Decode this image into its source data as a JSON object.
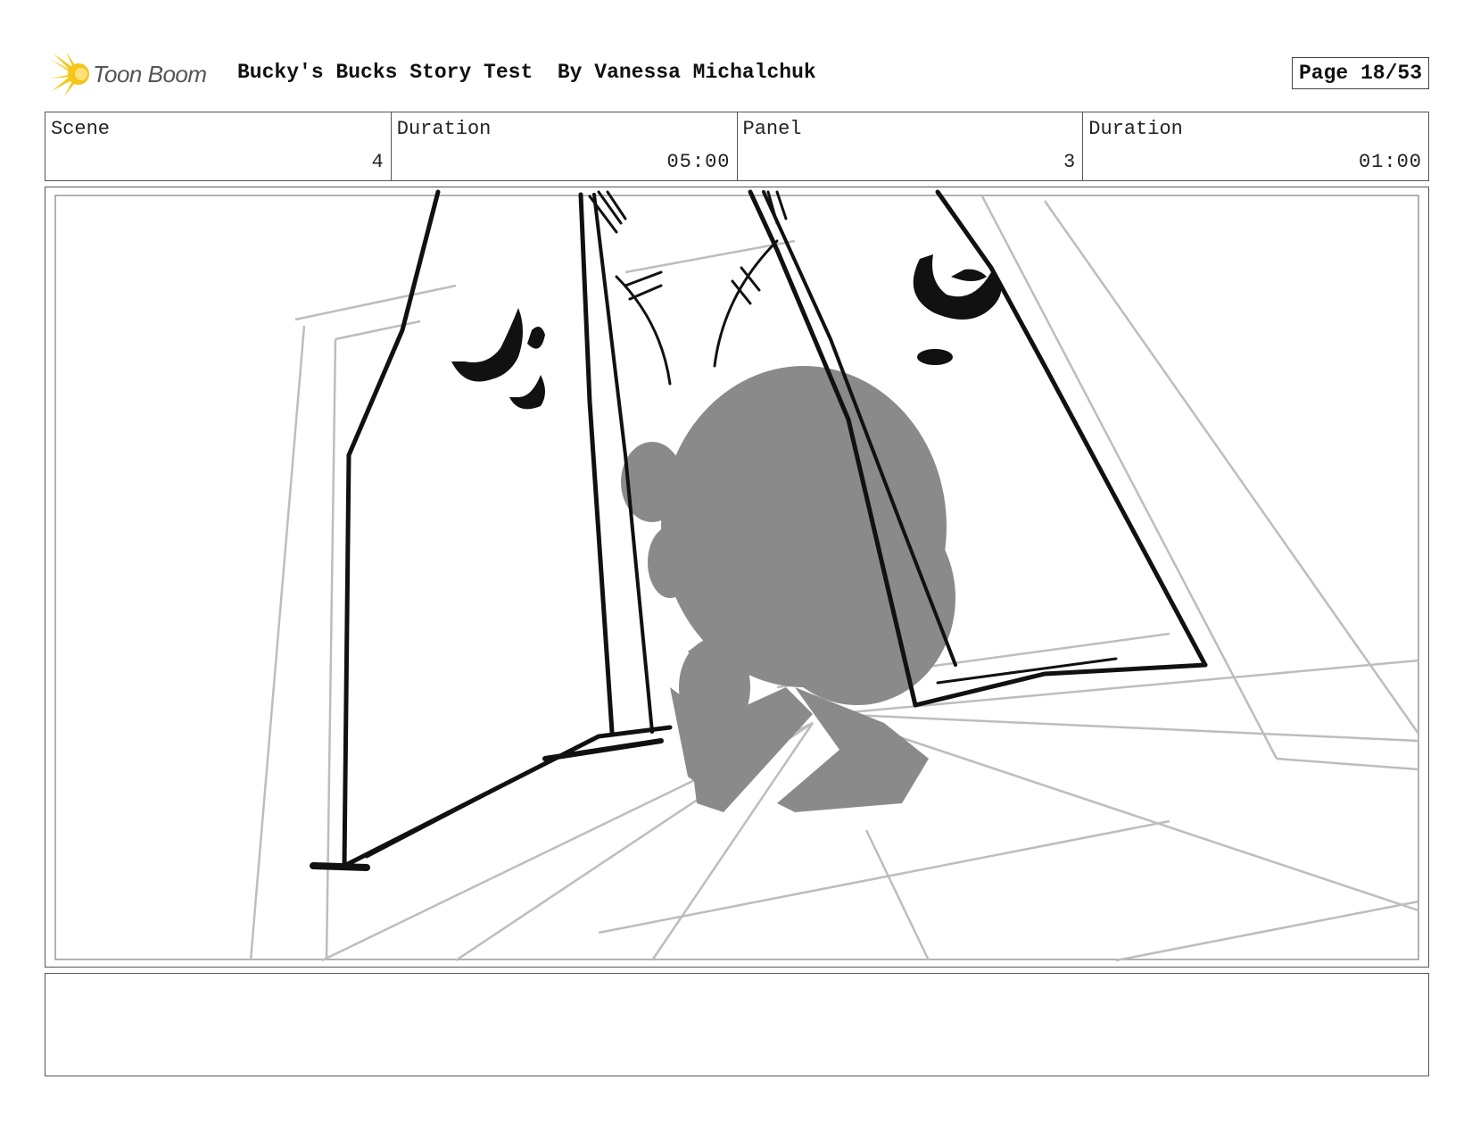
{
  "header": {
    "logo_text": "Toon Boom",
    "title": "Bucky's Bucks Story Test  By Vanessa Michalchuk",
    "page": "Page 18/53"
  },
  "info": {
    "scene_label": "Scene",
    "scene_value": "4",
    "scene_duration_label": "Duration",
    "scene_duration_value": "05:00",
    "panel_label": "Panel",
    "panel_value": "3",
    "panel_duration_label": "Duration",
    "panel_duration_value": "01:00"
  },
  "notes": {
    "text": ""
  },
  "colors": {
    "logo_accent": "#f5c518",
    "silhouette": "#8a8a8a",
    "guide_lines": "#bdbdbd",
    "ink": "#111111"
  }
}
